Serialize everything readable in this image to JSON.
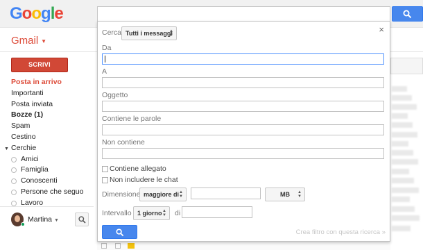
{
  "brand": {
    "logo_letters": [
      {
        "ch": "G",
        "color": "#4285f4"
      },
      {
        "ch": "o",
        "color": "#ea4335"
      },
      {
        "ch": "o",
        "color": "#fbbc05"
      },
      {
        "ch": "g",
        "color": "#4285f4"
      },
      {
        "ch": "l",
        "color": "#34a853"
      },
      {
        "ch": "e",
        "color": "#ea4335"
      }
    ],
    "app_label": "Gmail"
  },
  "sidebar": {
    "compose_label": "SCRIVI",
    "items": [
      {
        "label": "Posta in arrivo",
        "style": "active"
      },
      {
        "label": "Importanti",
        "style": ""
      },
      {
        "label": "Posta inviata",
        "style": ""
      },
      {
        "label": "Bozze (1)",
        "style": "bold"
      },
      {
        "label": "Spam",
        "style": ""
      },
      {
        "label": "Cestino",
        "style": ""
      }
    ],
    "circles_label": "Cerchie",
    "circles": [
      "Amici",
      "Famiglia",
      "Conoscenti",
      "Persone che seguo",
      "Lavoro"
    ],
    "user_name": "Martina"
  },
  "advanced_search": {
    "search_in_label": "Cerca",
    "search_in_value": "Tutti i messaggi",
    "fields": [
      {
        "label": "Da",
        "value": ""
      },
      {
        "label": "A",
        "value": ""
      },
      {
        "label": "Oggetto",
        "value": ""
      },
      {
        "label": "Contiene le parole",
        "value": ""
      },
      {
        "label": "Non contiene",
        "value": ""
      }
    ],
    "has_attachment_label": "Contiene allegato",
    "exclude_chats_label": "Non includere le chat",
    "size_label": "Dimensione",
    "size_operator": "maggiore di",
    "size_value": "",
    "size_unit": "MB",
    "interval_label": "Intervallo",
    "interval_value": "1 giorno",
    "interval_of_label": "di",
    "interval_date": "",
    "create_filter_label": "Crea filtro con questa ricerca »",
    "close_symbol": "×"
  },
  "colors": {
    "accent_red": "#dd4b39",
    "compose_red": "#d14836",
    "search_blue": "#4787ed",
    "focus_blue": "#4d90fe"
  },
  "icons": [
    "search-icon",
    "close-icon",
    "chevron-down-icon",
    "circle-icon",
    "avatar",
    "folder-icon"
  ]
}
